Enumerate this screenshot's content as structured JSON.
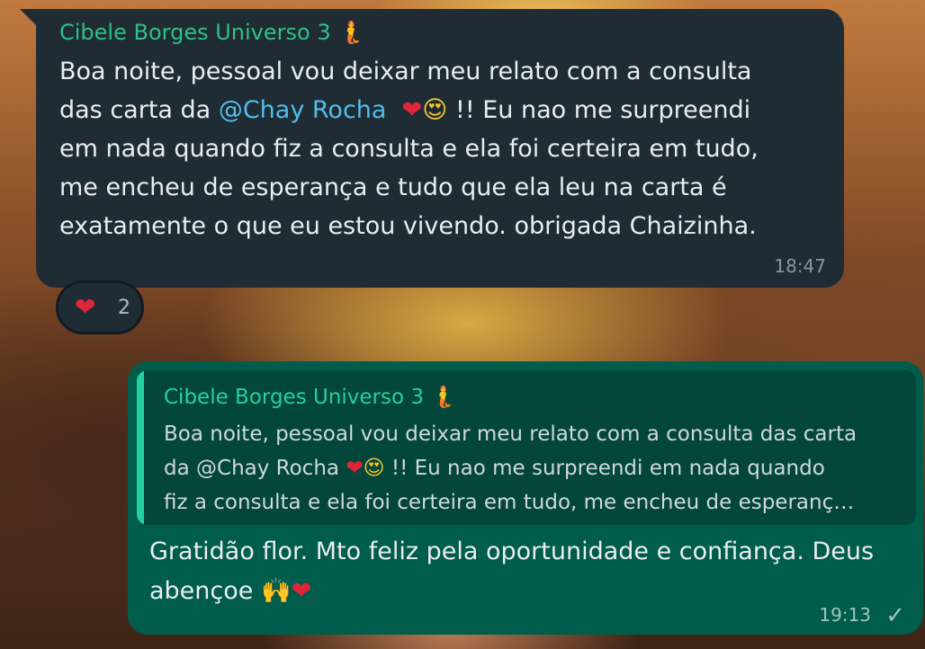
{
  "incoming_message": {
    "sender": "Cibele Borges Universo 3",
    "sender_emoji": "🧜",
    "line1": "Boa noite, pessoal vou deixar meu relato com a consulta",
    "line2_pre": "das carta da ",
    "mention": "@Chay Rocha",
    "emoji_heart": "❤",
    "emoji_love": "😍",
    "line2_post": " !! Eu nao me surpreendi",
    "line3": "em nada quando fiz a consulta e ela foi certeira em tudo,",
    "line4": "me encheu de esperança e tudo que ela leu na carta é",
    "line5": "exatamente o que eu estou vivendo. obrigada Chaizinha.",
    "time": "18:47"
  },
  "reaction": {
    "emoji": "❤",
    "count": "2"
  },
  "outgoing_message": {
    "quote": {
      "sender": "Cibele Borges Universo 3",
      "sender_emoji": "🧜",
      "line1": "Boa noite, pessoal vou deixar meu relato com a consulta das carta",
      "line2_pre": "da @Chay Rocha ",
      "emoji_heart": "❤",
      "emoji_love": "😍",
      "line2_post": " !! Eu nao me surpreendi em nada quando",
      "line3": "fiz a consulta e ela foi certeira em tudo, me encheu de esperanç…"
    },
    "text_line1": "Gratidão flor. Mto feliz pela oportunidade e confiança. Deus",
    "text_line2": "abençoe ",
    "emoji_hands": "🙌",
    "emoji_heart": "❤",
    "time": "19:13",
    "status_icon": "single-check-icon"
  },
  "colors": {
    "incoming_bubble": "#1f2c34",
    "outgoing_bubble": "#005c4b",
    "sender_name": "#2fbf8a",
    "mention": "#53bdeb"
  }
}
